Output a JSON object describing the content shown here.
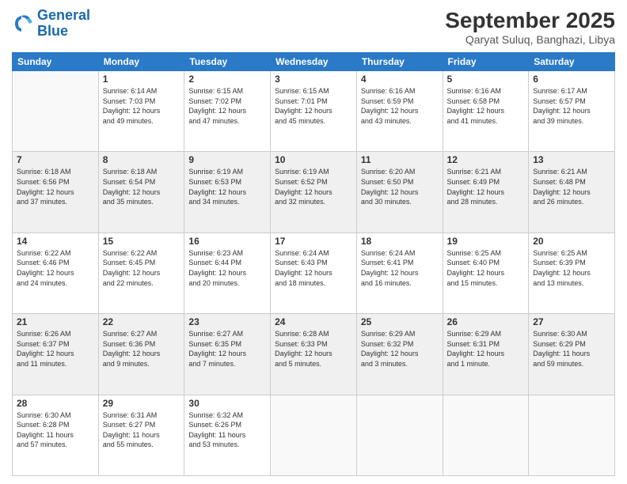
{
  "logo": {
    "line1": "General",
    "line2": "Blue"
  },
  "title": "September 2025",
  "location": "Qaryat Suluq, Banghazi, Libya",
  "weekdays": [
    "Sunday",
    "Monday",
    "Tuesday",
    "Wednesday",
    "Thursday",
    "Friday",
    "Saturday"
  ],
  "weeks": [
    [
      {
        "day": "",
        "info": ""
      },
      {
        "day": "1",
        "info": "Sunrise: 6:14 AM\nSunset: 7:03 PM\nDaylight: 12 hours\nand 49 minutes."
      },
      {
        "day": "2",
        "info": "Sunrise: 6:15 AM\nSunset: 7:02 PM\nDaylight: 12 hours\nand 47 minutes."
      },
      {
        "day": "3",
        "info": "Sunrise: 6:15 AM\nSunset: 7:01 PM\nDaylight: 12 hours\nand 45 minutes."
      },
      {
        "day": "4",
        "info": "Sunrise: 6:16 AM\nSunset: 6:59 PM\nDaylight: 12 hours\nand 43 minutes."
      },
      {
        "day": "5",
        "info": "Sunrise: 6:16 AM\nSunset: 6:58 PM\nDaylight: 12 hours\nand 41 minutes."
      },
      {
        "day": "6",
        "info": "Sunrise: 6:17 AM\nSunset: 6:57 PM\nDaylight: 12 hours\nand 39 minutes."
      }
    ],
    [
      {
        "day": "7",
        "info": "Sunrise: 6:18 AM\nSunset: 6:56 PM\nDaylight: 12 hours\nand 37 minutes."
      },
      {
        "day": "8",
        "info": "Sunrise: 6:18 AM\nSunset: 6:54 PM\nDaylight: 12 hours\nand 35 minutes."
      },
      {
        "day": "9",
        "info": "Sunrise: 6:19 AM\nSunset: 6:53 PM\nDaylight: 12 hours\nand 34 minutes."
      },
      {
        "day": "10",
        "info": "Sunrise: 6:19 AM\nSunset: 6:52 PM\nDaylight: 12 hours\nand 32 minutes."
      },
      {
        "day": "11",
        "info": "Sunrise: 6:20 AM\nSunset: 6:50 PM\nDaylight: 12 hours\nand 30 minutes."
      },
      {
        "day": "12",
        "info": "Sunrise: 6:21 AM\nSunset: 6:49 PM\nDaylight: 12 hours\nand 28 minutes."
      },
      {
        "day": "13",
        "info": "Sunrise: 6:21 AM\nSunset: 6:48 PM\nDaylight: 12 hours\nand 26 minutes."
      }
    ],
    [
      {
        "day": "14",
        "info": "Sunrise: 6:22 AM\nSunset: 6:46 PM\nDaylight: 12 hours\nand 24 minutes."
      },
      {
        "day": "15",
        "info": "Sunrise: 6:22 AM\nSunset: 6:45 PM\nDaylight: 12 hours\nand 22 minutes."
      },
      {
        "day": "16",
        "info": "Sunrise: 6:23 AM\nSunset: 6:44 PM\nDaylight: 12 hours\nand 20 minutes."
      },
      {
        "day": "17",
        "info": "Sunrise: 6:24 AM\nSunset: 6:43 PM\nDaylight: 12 hours\nand 18 minutes."
      },
      {
        "day": "18",
        "info": "Sunrise: 6:24 AM\nSunset: 6:41 PM\nDaylight: 12 hours\nand 16 minutes."
      },
      {
        "day": "19",
        "info": "Sunrise: 6:25 AM\nSunset: 6:40 PM\nDaylight: 12 hours\nand 15 minutes."
      },
      {
        "day": "20",
        "info": "Sunrise: 6:25 AM\nSunset: 6:39 PM\nDaylight: 12 hours\nand 13 minutes."
      }
    ],
    [
      {
        "day": "21",
        "info": "Sunrise: 6:26 AM\nSunset: 6:37 PM\nDaylight: 12 hours\nand 11 minutes."
      },
      {
        "day": "22",
        "info": "Sunrise: 6:27 AM\nSunset: 6:36 PM\nDaylight: 12 hours\nand 9 minutes."
      },
      {
        "day": "23",
        "info": "Sunrise: 6:27 AM\nSunset: 6:35 PM\nDaylight: 12 hours\nand 7 minutes."
      },
      {
        "day": "24",
        "info": "Sunrise: 6:28 AM\nSunset: 6:33 PM\nDaylight: 12 hours\nand 5 minutes."
      },
      {
        "day": "25",
        "info": "Sunrise: 6:29 AM\nSunset: 6:32 PM\nDaylight: 12 hours\nand 3 minutes."
      },
      {
        "day": "26",
        "info": "Sunrise: 6:29 AM\nSunset: 6:31 PM\nDaylight: 12 hours\nand 1 minute."
      },
      {
        "day": "27",
        "info": "Sunrise: 6:30 AM\nSunset: 6:29 PM\nDaylight: 11 hours\nand 59 minutes."
      }
    ],
    [
      {
        "day": "28",
        "info": "Sunrise: 6:30 AM\nSunset: 6:28 PM\nDaylight: 11 hours\nand 57 minutes."
      },
      {
        "day": "29",
        "info": "Sunrise: 6:31 AM\nSunset: 6:27 PM\nDaylight: 11 hours\nand 55 minutes."
      },
      {
        "day": "30",
        "info": "Sunrise: 6:32 AM\nSunset: 6:26 PM\nDaylight: 11 hours\nand 53 minutes."
      },
      {
        "day": "",
        "info": ""
      },
      {
        "day": "",
        "info": ""
      },
      {
        "day": "",
        "info": ""
      },
      {
        "day": "",
        "info": ""
      }
    ]
  ]
}
